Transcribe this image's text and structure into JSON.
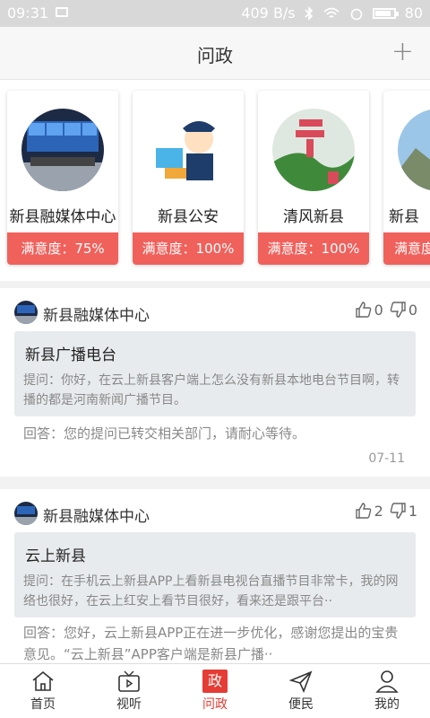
{
  "status_bar": {
    "time": "09:31",
    "speed": "409 B/s",
    "battery": "80"
  },
  "header": {
    "title": "问政",
    "add_label": "+"
  },
  "cards": [
    {
      "name": "新县融媒体中心",
      "satisfaction": "满意度：75%"
    },
    {
      "name": "新县公安",
      "satisfaction": "满意度：100%"
    },
    {
      "name": "清风新县",
      "satisfaction": "满意度：100%"
    },
    {
      "name": "新县",
      "satisfaction": "满意度"
    }
  ],
  "posts": [
    {
      "author": "新县融媒体中心",
      "likes": "0",
      "dislikes": "0",
      "question_title": "新县广播电台",
      "question_text": "提问：你好，在云上新县客户端上怎么没有新县本地电台节目啊，转播的都是河南新闻广播节目。",
      "answer": "回答：您的提问已转交相关部门，请耐心等待。",
      "date": "07-11"
    },
    {
      "author": "新县融媒体中心",
      "likes": "2",
      "dislikes": "1",
      "question_title": "云上新县",
      "question_text": "提问：在手机云上新县APP上看新县电视台直播节目非常卡，我的网络也很好，在云上红安上看节目很好，看来还是跟平台··",
      "answer": "回答：您好，云上新县APP正在进一步优化，感谢您提出的宝贵意见。“云上新县”APP客户端是新县广播··"
    }
  ],
  "nav": [
    {
      "label": "首页",
      "icon": "home-icon"
    },
    {
      "label": "视听",
      "icon": "tv-icon"
    },
    {
      "label": "问政",
      "icon": "zheng-badge-icon",
      "badge": "政",
      "active": true
    },
    {
      "label": "便民",
      "icon": "send-icon"
    },
    {
      "label": "我的",
      "icon": "user-icon"
    }
  ],
  "colors": {
    "accent": "#e33d35",
    "card_bar": "#f0615c"
  }
}
